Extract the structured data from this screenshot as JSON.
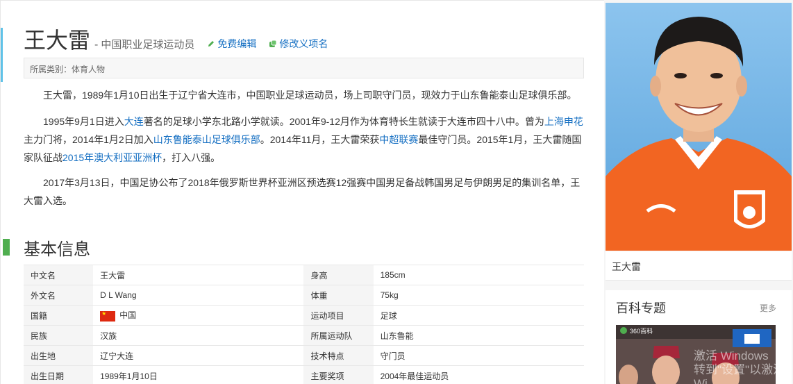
{
  "title": {
    "name": "王大雷",
    "dash": "-",
    "desc": "中国职业足球运动员",
    "edit_label": "免费编辑",
    "rename_label": "修改义项名"
  },
  "category": "所属类别：体育人物",
  "paragraphs": {
    "p1": "王大雷，1989年1月10日出生于辽宁省大连市，中国职业足球运动员，场上司职守门员，现效力于山东鲁能泰山足球俱乐部。",
    "p2": {
      "t1": "1995年9月1日进入",
      "l1": "大连",
      "t2": "著名的足球小学东北路小学就读。2001年9-12月作为体育特长生就读于大连市四十八中。曾为",
      "l2": "上海申花",
      "t3": "主力门将，2014年1月2日加入",
      "l3": "山东鲁能泰山足球俱乐部",
      "t4": "。2014年11月，王大雷荣获",
      "l4": "中超联赛",
      "t5": "最佳守门员。2015年1月，王大雷随国家队征战",
      "l5": "2015年澳大利亚亚洲杯",
      "t6": "，打入八强。"
    },
    "p3": "2017年3月13日，中国足协公布了2018年俄罗斯世界杯亚洲区预选赛12强赛中国男足备战韩国男足与伊朗男足的集训名单，王大雷入选。"
  },
  "basic_info": {
    "title": "基本信息",
    "rows": [
      {
        "k1": "中文名",
        "v1": "王大雷",
        "k2": "身高",
        "v2": "185cm"
      },
      {
        "k1": "外文名",
        "v1": "D L Wang",
        "k2": "体重",
        "v2": "75kg"
      },
      {
        "k1": "国籍",
        "v1": "中国",
        "k2": "运动项目",
        "v2": "足球"
      },
      {
        "k1": "民族",
        "v1": "汉族",
        "k2": "所属运动队",
        "v2": "山东鲁能"
      },
      {
        "k1": "出生地",
        "v1": "辽宁大连",
        "k2": "技术特点",
        "v2": "守门员"
      },
      {
        "k1": "出生日期",
        "v1": "1989年1月10日",
        "k2": "主要奖项",
        "v2": "2004年最佳运动员"
      }
    ]
  },
  "sidebar": {
    "photo_caption": "王大雷",
    "topic_title": "百科专题",
    "topic_more": "更多",
    "topic_badge": "360百科"
  },
  "watermark": {
    "line1": "激活 Windows",
    "line2": "转到\"设置\"以激活 Wi"
  },
  "colors": {
    "link": "#136ec2",
    "accent_green": "#4fae4f",
    "accent_blue": "#5fc2e8",
    "jersey_orange": "#f26522"
  }
}
